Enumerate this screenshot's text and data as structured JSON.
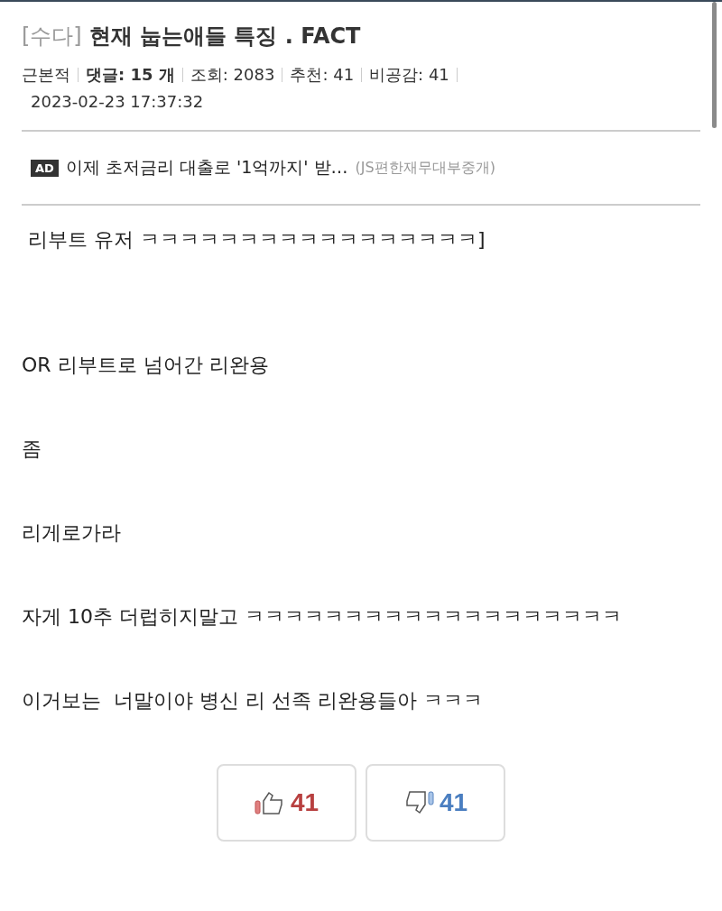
{
  "post": {
    "category": "[수다]",
    "title": "현재 눕는애들 특징 . FACT",
    "meta": {
      "author": "근본적",
      "comments": "댓글: 15 개",
      "views": "조회: 2083",
      "recommend": "추천: 41",
      "unlike": "비공감: 41",
      "date": "2023-02-23 17:37:32"
    }
  },
  "ad": {
    "badge": "AD",
    "text": "이제 초저금리 대출로 '1억까지' 받…",
    "source": "(JS편한재무대부중개)"
  },
  "body": [
    " 리부트 유저 ㅋㅋㅋㅋㅋㅋㅋㅋㅋㅋㅋㅋㅋㅋㅋㅋㅋ]",
    "OR 리부트로 넘어간 리완용",
    "좀",
    "리게로가라",
    "자게 10추 더럽히지말고 ㅋㅋㅋㅋㅋㅋㅋㅋㅋㅋㅋㅋㅋㅋㅋㅋㅋㅋㅋ",
    "이거보는  너말이야 병신 리 선족 리완용들아 ㅋㅋㅋ"
  ],
  "votes": {
    "up": "41",
    "down": "41"
  }
}
